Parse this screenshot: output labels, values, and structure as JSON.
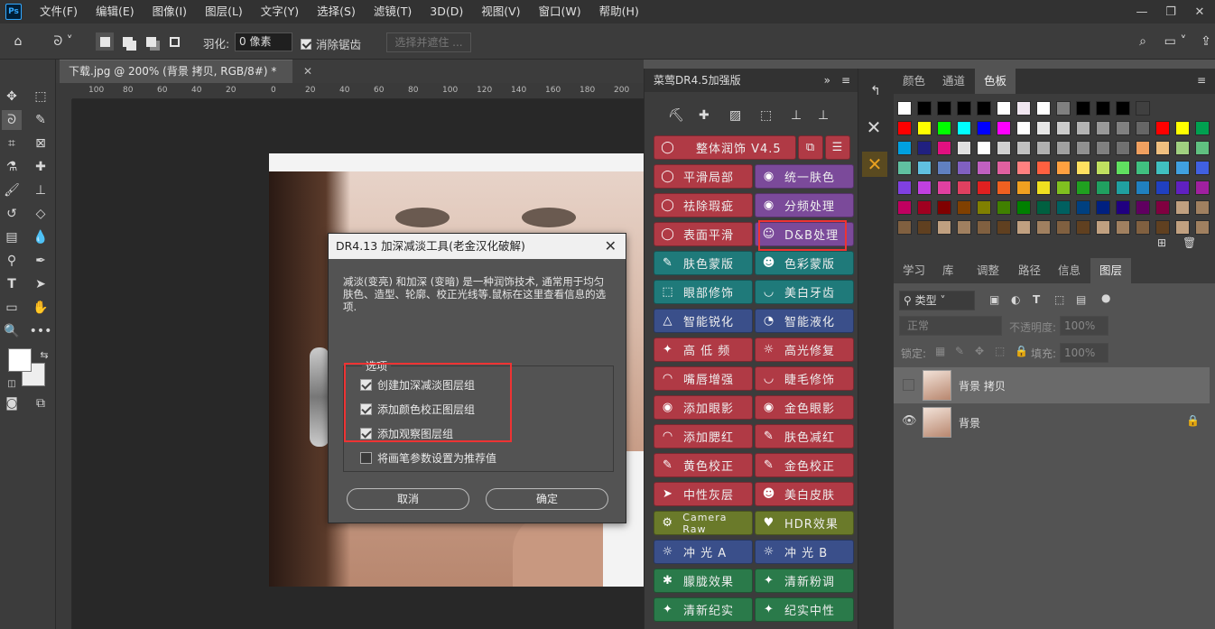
{
  "menubar": {
    "logo": "Ps",
    "items": [
      "文件(F)",
      "编辑(E)",
      "图像(I)",
      "图层(L)",
      "文字(Y)",
      "选择(S)",
      "滤镜(T)",
      "3D(D)",
      "视图(V)",
      "窗口(W)",
      "帮助(H)"
    ]
  },
  "optbar": {
    "feather_label": "羽化:",
    "feather_value": "0 像素",
    "antialias_label": "消除锯齿",
    "select_mask": "选择并遮住 ..."
  },
  "document": {
    "tab_title": "下载.jpg @ 200% (背景 拷贝, RGB/8#) *",
    "ruler_ticks": [
      "100",
      "80",
      "60",
      "40",
      "20",
      "0",
      "20",
      "40",
      "60",
      "80",
      "100",
      "120",
      "140",
      "160",
      "180",
      "200"
    ]
  },
  "dialog": {
    "title": "DR4.13 加深减淡工具(老金汉化破解)",
    "description": "减淡(变亮) 和加深 (变暗) 是一种润饰技术, 通常用于均匀肤色、造型、轮廓、校正光线等.鼠标在这里查看信息的选项.",
    "group_label": "选项",
    "options": [
      {
        "label": "创建加深减淡图层组",
        "checked": true
      },
      {
        "label": "添加颜色校正图层组",
        "checked": true
      },
      {
        "label": "添加观察图层组",
        "checked": true
      },
      {
        "label": "将画笔参数设置为推荐值",
        "checked": false
      }
    ],
    "cancel": "取消",
    "ok": "确定"
  },
  "drpanel": {
    "title": "菜莺DR4.5加强版",
    "top_button": "整体润饰 V4.5",
    "buttons": [
      [
        "平滑局部",
        "统一肤色"
      ],
      [
        "祛除瑕疵",
        "分频处理"
      ],
      [
        "表面平滑",
        "D&B处理"
      ],
      [
        "肤色蒙版",
        "色彩蒙版"
      ],
      [
        "眼部修饰",
        "美白牙齿"
      ],
      [
        "智能锐化",
        "智能液化"
      ],
      [
        "高 低 频",
        "高光修复"
      ],
      [
        "嘴唇增强",
        "睫毛修饰"
      ],
      [
        "添加眼影",
        "金色眼影"
      ],
      [
        "添加腮红",
        "肤色减红"
      ],
      [
        "黄色校正",
        "金色校正"
      ],
      [
        "中性灰层",
        "美白皮肤"
      ],
      [
        "Camera Raw",
        "HDR效果"
      ],
      [
        "冲 光 A",
        "冲 光 B"
      ],
      [
        "朦胧效果",
        "清新粉调"
      ],
      [
        "清新纪实",
        "纪实中性"
      ]
    ]
  },
  "swatches": {
    "tabs": [
      "颜色",
      "通道",
      "色板"
    ],
    "active_tab": "色板"
  },
  "layers": {
    "tabs": [
      "学习",
      "库",
      "调整",
      "路径",
      "信息",
      "图层"
    ],
    "active_tab": "图层",
    "filter": "类型",
    "blend": "正常",
    "opacity_label": "不透明度:",
    "opacity": "100%",
    "lock_label": "锁定:",
    "fill_label": "填充:",
    "fill": "100%",
    "items": [
      {
        "name": "背景 拷贝",
        "visible": false,
        "selected": true
      },
      {
        "name": "背景",
        "visible": true,
        "locked": true
      }
    ]
  }
}
